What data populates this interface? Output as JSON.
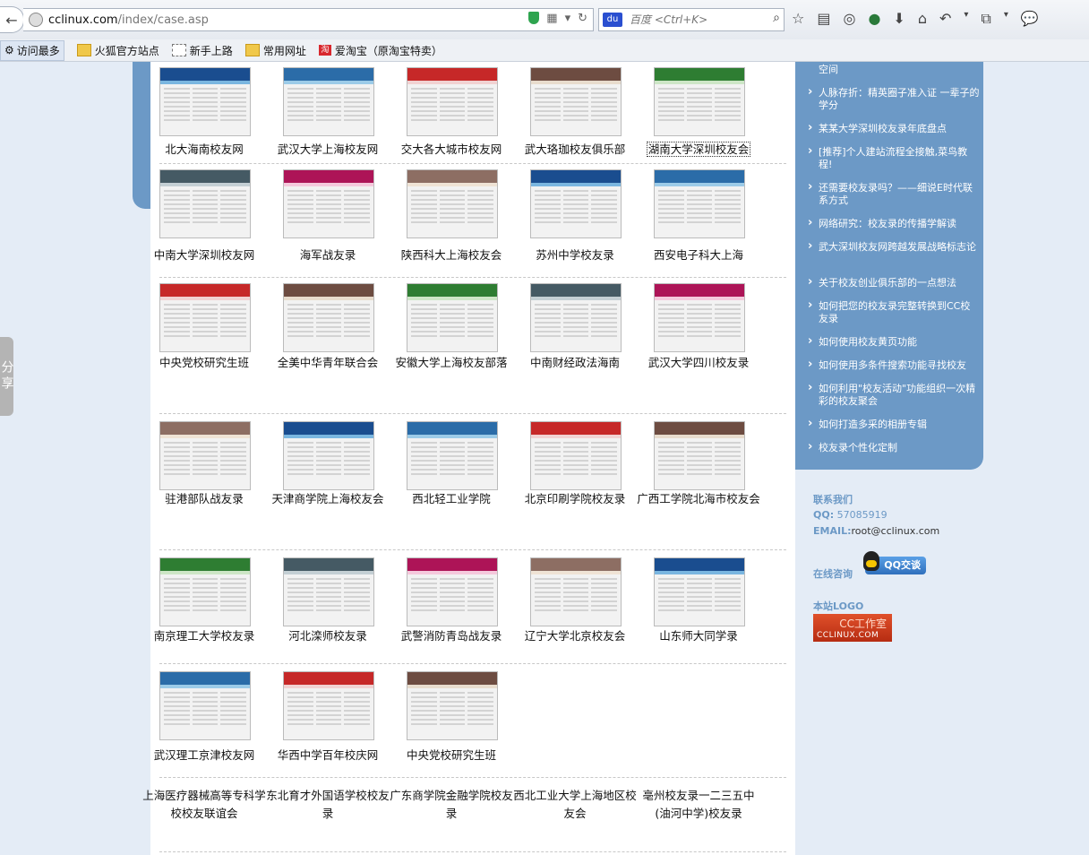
{
  "browser": {
    "url_host": "cclinux.com",
    "url_path": "/index/case.asp",
    "search_placeholder": "百度 <Ctrl+K>",
    "search_engine_badge": "du"
  },
  "bookmarks": [
    {
      "label": "访问最多",
      "icon": "gear-icon",
      "active": true
    },
    {
      "label": "火狐官方站点",
      "icon": "folder-icon"
    },
    {
      "label": "新手上路",
      "icon": "page-icon"
    },
    {
      "label": "常用网址",
      "icon": "folder-icon"
    },
    {
      "label": "爱淘宝（原淘宝特卖）",
      "icon": "taobao-icon",
      "badge": "淘"
    }
  ],
  "share_label": "分享",
  "cases": [
    {
      "items": [
        "北大海南校友网",
        "武汉大学上海校友网",
        "交大各大城市校友网",
        "武大珞珈校友俱乐部",
        "湖南大学深圳校友会"
      ]
    },
    {
      "items": [
        "中南大学深圳校友网",
        "海军战友录",
        "陕西科大上海校友会",
        "苏州中学校友录",
        "西安电子科大上海"
      ]
    },
    {
      "items": [
        "中央党校研究生班",
        "全美中华青年联合会",
        "安徽大学上海校友部落",
        "中南财经政法海南",
        "武汉大学四川校友录"
      ]
    },
    {
      "items": [
        "驻港部队战友录",
        "天津商学院上海校友会",
        "西北轻工业学院",
        "北京印刷学院校友录",
        "广西工学院北海市校友会"
      ]
    },
    {
      "items": [
        "南京理工大学校友录",
        "河北滦师校友录",
        "武警消防青岛战友录",
        "辽宁大学北京校友会",
        "山东师大同学录"
      ]
    },
    {
      "items": [
        "武汉理工京津校友网",
        "华西中学百年校庆网",
        "中央党校研究生班"
      ]
    },
    {
      "items": [
        "上海医疗器械高等专科学校校友联谊会",
        "东北育才外国语学校校友录",
        "广东商学院金融学院校友录",
        "西北工业大学上海地区校友会",
        "亳州校友录一二三五中(油河中学)校友录"
      ]
    }
  ],
  "sidebar": {
    "items": [
      "空间",
      "人脉存折：精英圈子准入证 一辈子的学分",
      "某某大学深圳校友录年底盘点",
      "[推荐]个人建站流程全接触,菜鸟教程!",
      "还需要校友录吗？——细说E时代联系方式",
      "网络研究：校友录的传播学解读",
      "武大深圳校友网跨越发展战略标志论",
      "关于校友创业俱乐部的一点想法",
      "如何把您的校友录完整转换到CC校友录",
      "如何使用校友黄页功能",
      "如何使用多条件搜索功能寻找校友",
      "如何利用\"校友活动\"功能组织一次精彩的校友聚会",
      "如何打造多采的相册专辑",
      "校友录个性化定制"
    ]
  },
  "contact": {
    "title": "联系我们",
    "qq_label": "QQ:",
    "qq_value": "57085919",
    "email_label": "EMAIL:",
    "email_value": "root@cclinux.com",
    "online_label": "在线咨询",
    "qq_button": "QQ交谈",
    "logo_label": "本站LOGO",
    "logo_text_top": "CC工作室",
    "logo_text_bottom": "CCLINUX.COM"
  }
}
